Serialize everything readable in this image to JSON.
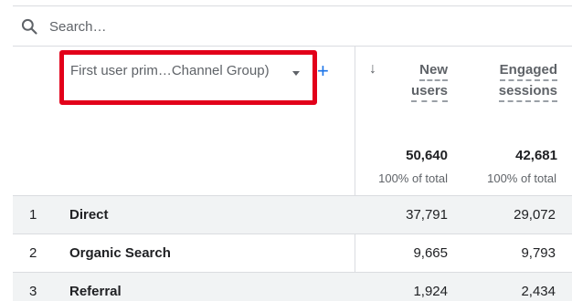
{
  "search": {
    "placeholder": "Search…"
  },
  "dimension": {
    "label": "First user prim…Channel Group)"
  },
  "add_dimension_symbol": "+",
  "sort_symbol": "↓",
  "columns": [
    {
      "line1": "New",
      "line2": "users",
      "total": "50,640",
      "total_sub": "100% of total"
    },
    {
      "line1": "Engaged",
      "line2": "sessions",
      "total": "42,681",
      "total_sub": "100% of total"
    }
  ],
  "rows": [
    {
      "index": "1",
      "name": "Direct",
      "new_users": "37,791",
      "engaged_sessions": "29,072"
    },
    {
      "index": "2",
      "name": "Organic Search",
      "new_users": "9,665",
      "engaged_sessions": "9,793"
    },
    {
      "index": "3",
      "name": "Referral",
      "new_users": "1,924",
      "engaged_sessions": "2,434"
    }
  ],
  "colors": {
    "highlight": "#e2001a",
    "accent": "#1a73e8",
    "row_shade": "#f1f3f4"
  }
}
